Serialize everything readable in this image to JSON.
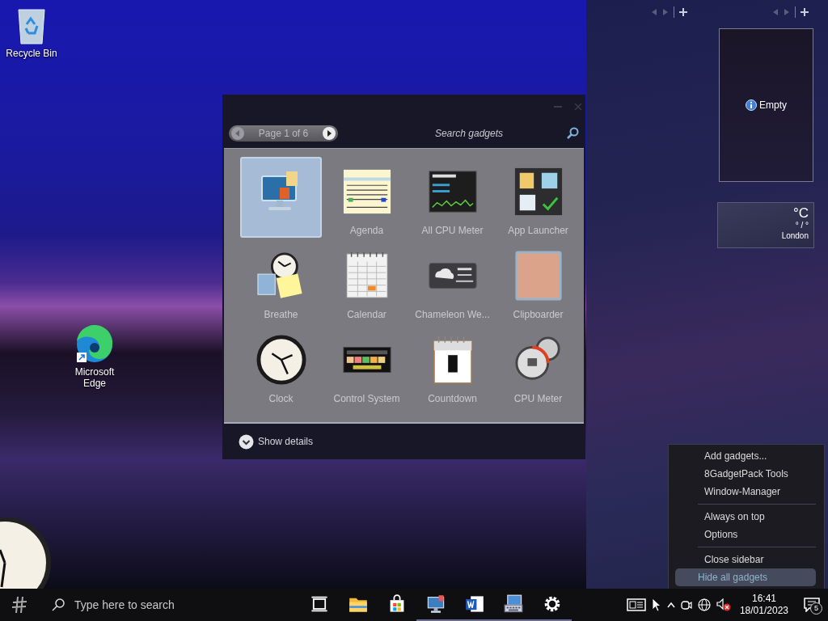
{
  "desktop": {
    "icons": [
      {
        "kind": "recycle-bin",
        "label": "Recycle Bin"
      },
      {
        "kind": "edge",
        "label": "Microsoft Edge"
      }
    ]
  },
  "gadget_gallery": {
    "pager": "Page 1 of 6",
    "search": {
      "placeholder": "Search gadgets"
    },
    "gadgets": [
      {
        "kind": "monitor",
        "selected": true
      },
      {
        "kind": "agenda",
        "label": "Agenda",
        "selected": false
      },
      {
        "kind": "meter",
        "label": "All CPU Meter",
        "selected": false
      },
      {
        "kind": "launcher",
        "label": "App Launcher",
        "selected": false
      },
      {
        "kind": "notes",
        "label": "Breathe",
        "selected": false
      },
      {
        "kind": "calendar",
        "label": "Calendar",
        "selected": false
      },
      {
        "kind": "weather",
        "label": "Chameleon We...",
        "selected": false
      },
      {
        "kind": "photo",
        "label": "Clipboarder",
        "selected": false
      },
      {
        "kind": "clock",
        "label": "Clock",
        "selected": false
      },
      {
        "kind": "panel",
        "label": "Control System",
        "selected": false
      },
      {
        "kind": "countdown",
        "label": "Countdown",
        "selected": false
      },
      {
        "kind": "gauges",
        "label": "CPU Meter",
        "selected": false
      }
    ],
    "details_toggle": "Show details"
  },
  "sidebar": {
    "empty_gadget": "Empty",
    "weather": {
      "temperature": "°C",
      "range": "° / °",
      "city": "London"
    }
  },
  "context_menu": {
    "groups": [
      [
        {
          "label": "Add gadgets...",
          "selected": false
        },
        {
          "label": "8GadgetPack Tools",
          "selected": false
        },
        {
          "label": "Window-Manager",
          "selected": false
        }
      ],
      [
        {
          "label": "Always on top",
          "selected": false
        },
        {
          "label": "Options",
          "selected": false
        }
      ],
      [
        {
          "label": "Close sidebar",
          "selected": false
        },
        {
          "label": "Hide all gadgets",
          "selected": true
        }
      ]
    ]
  },
  "taskbar": {
    "search": {
      "placeholder": "Type here to search"
    },
    "apps": [
      {
        "kind": "task-view",
        "running": false
      },
      {
        "kind": "folder",
        "running": false
      },
      {
        "kind": "store",
        "running": false
      },
      {
        "kind": "monitor",
        "running": true
      },
      {
        "kind": "word",
        "running": true
      },
      {
        "kind": "keyboard",
        "running": true
      },
      {
        "kind": "settings",
        "running": true
      }
    ],
    "clock": {
      "time": "16:41",
      "date": "18/01/2023"
    },
    "notifications": "5"
  }
}
